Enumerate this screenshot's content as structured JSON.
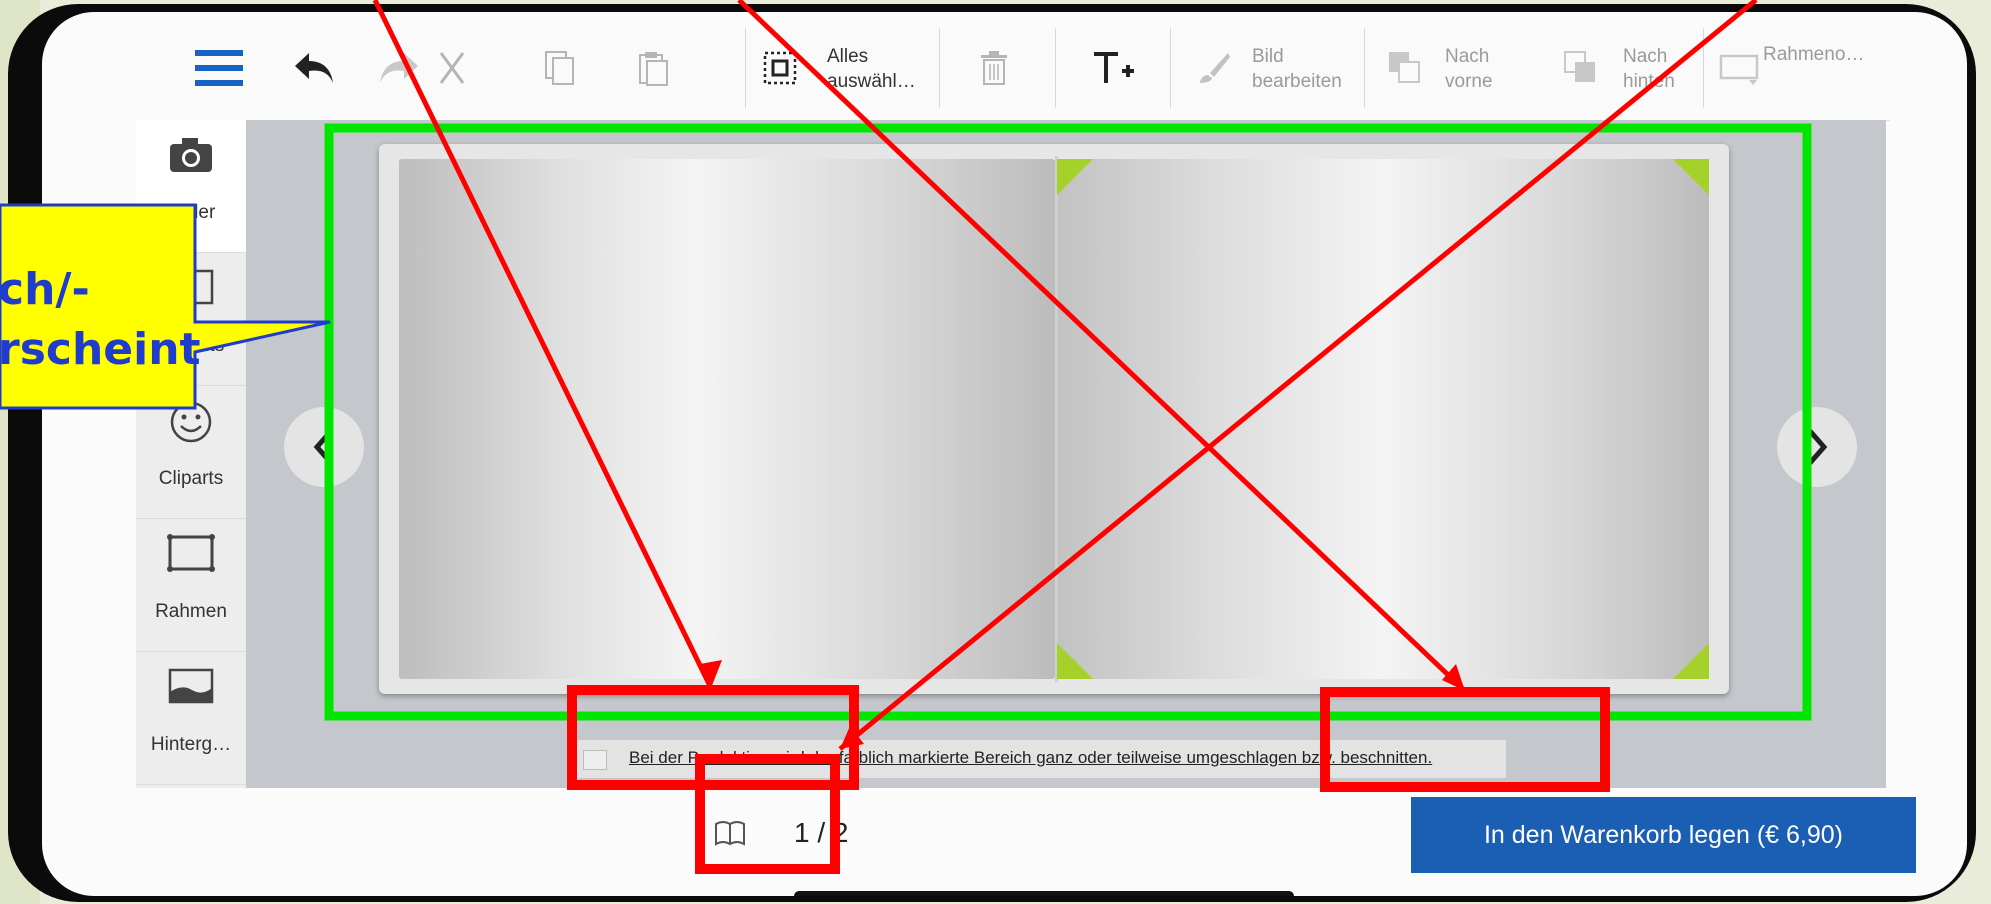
{
  "toolbar": {
    "undo_label": "",
    "select_all_label": "Alles auswähl…",
    "edit_image_label": "Bild bearbeiten",
    "to_front_label": "Nach vorne",
    "to_back_label": "Nach hinten",
    "frame_label": "Rahmeno…"
  },
  "sidebar": {
    "items": [
      {
        "label": "Bilder",
        "icon": "camera-icon",
        "active": true
      },
      {
        "label": "Layouts",
        "icon": "layouts-icon",
        "active": false
      },
      {
        "label": "Cliparts",
        "icon": "smiley-icon",
        "active": false
      },
      {
        "label": "Rahmen",
        "icon": "frame-icon",
        "active": false
      },
      {
        "label": "Hinterg…",
        "icon": "background-icon",
        "active": false
      }
    ]
  },
  "editor": {
    "hint_text": "Bei der Produktion wird der farblich markierte Bereich ganz oder teilweise umgeschlagen bzw. beschnitten.",
    "page_indicator": "1 / 2",
    "cart_button": "In den Warenkorb legen (€ 6,90)"
  },
  "annotation": {
    "callout_line1": "ch/-",
    "callout_line2": "rscheint",
    "colors": {
      "callout_fill": "#ffff00",
      "callout_text": "#1f3ccc",
      "highlight_green": "#00e600",
      "marker_red": "#ff0000"
    }
  },
  "colors": {
    "accent_blue": "#1b5fb4",
    "menu_icon_blue": "#1565c0"
  }
}
